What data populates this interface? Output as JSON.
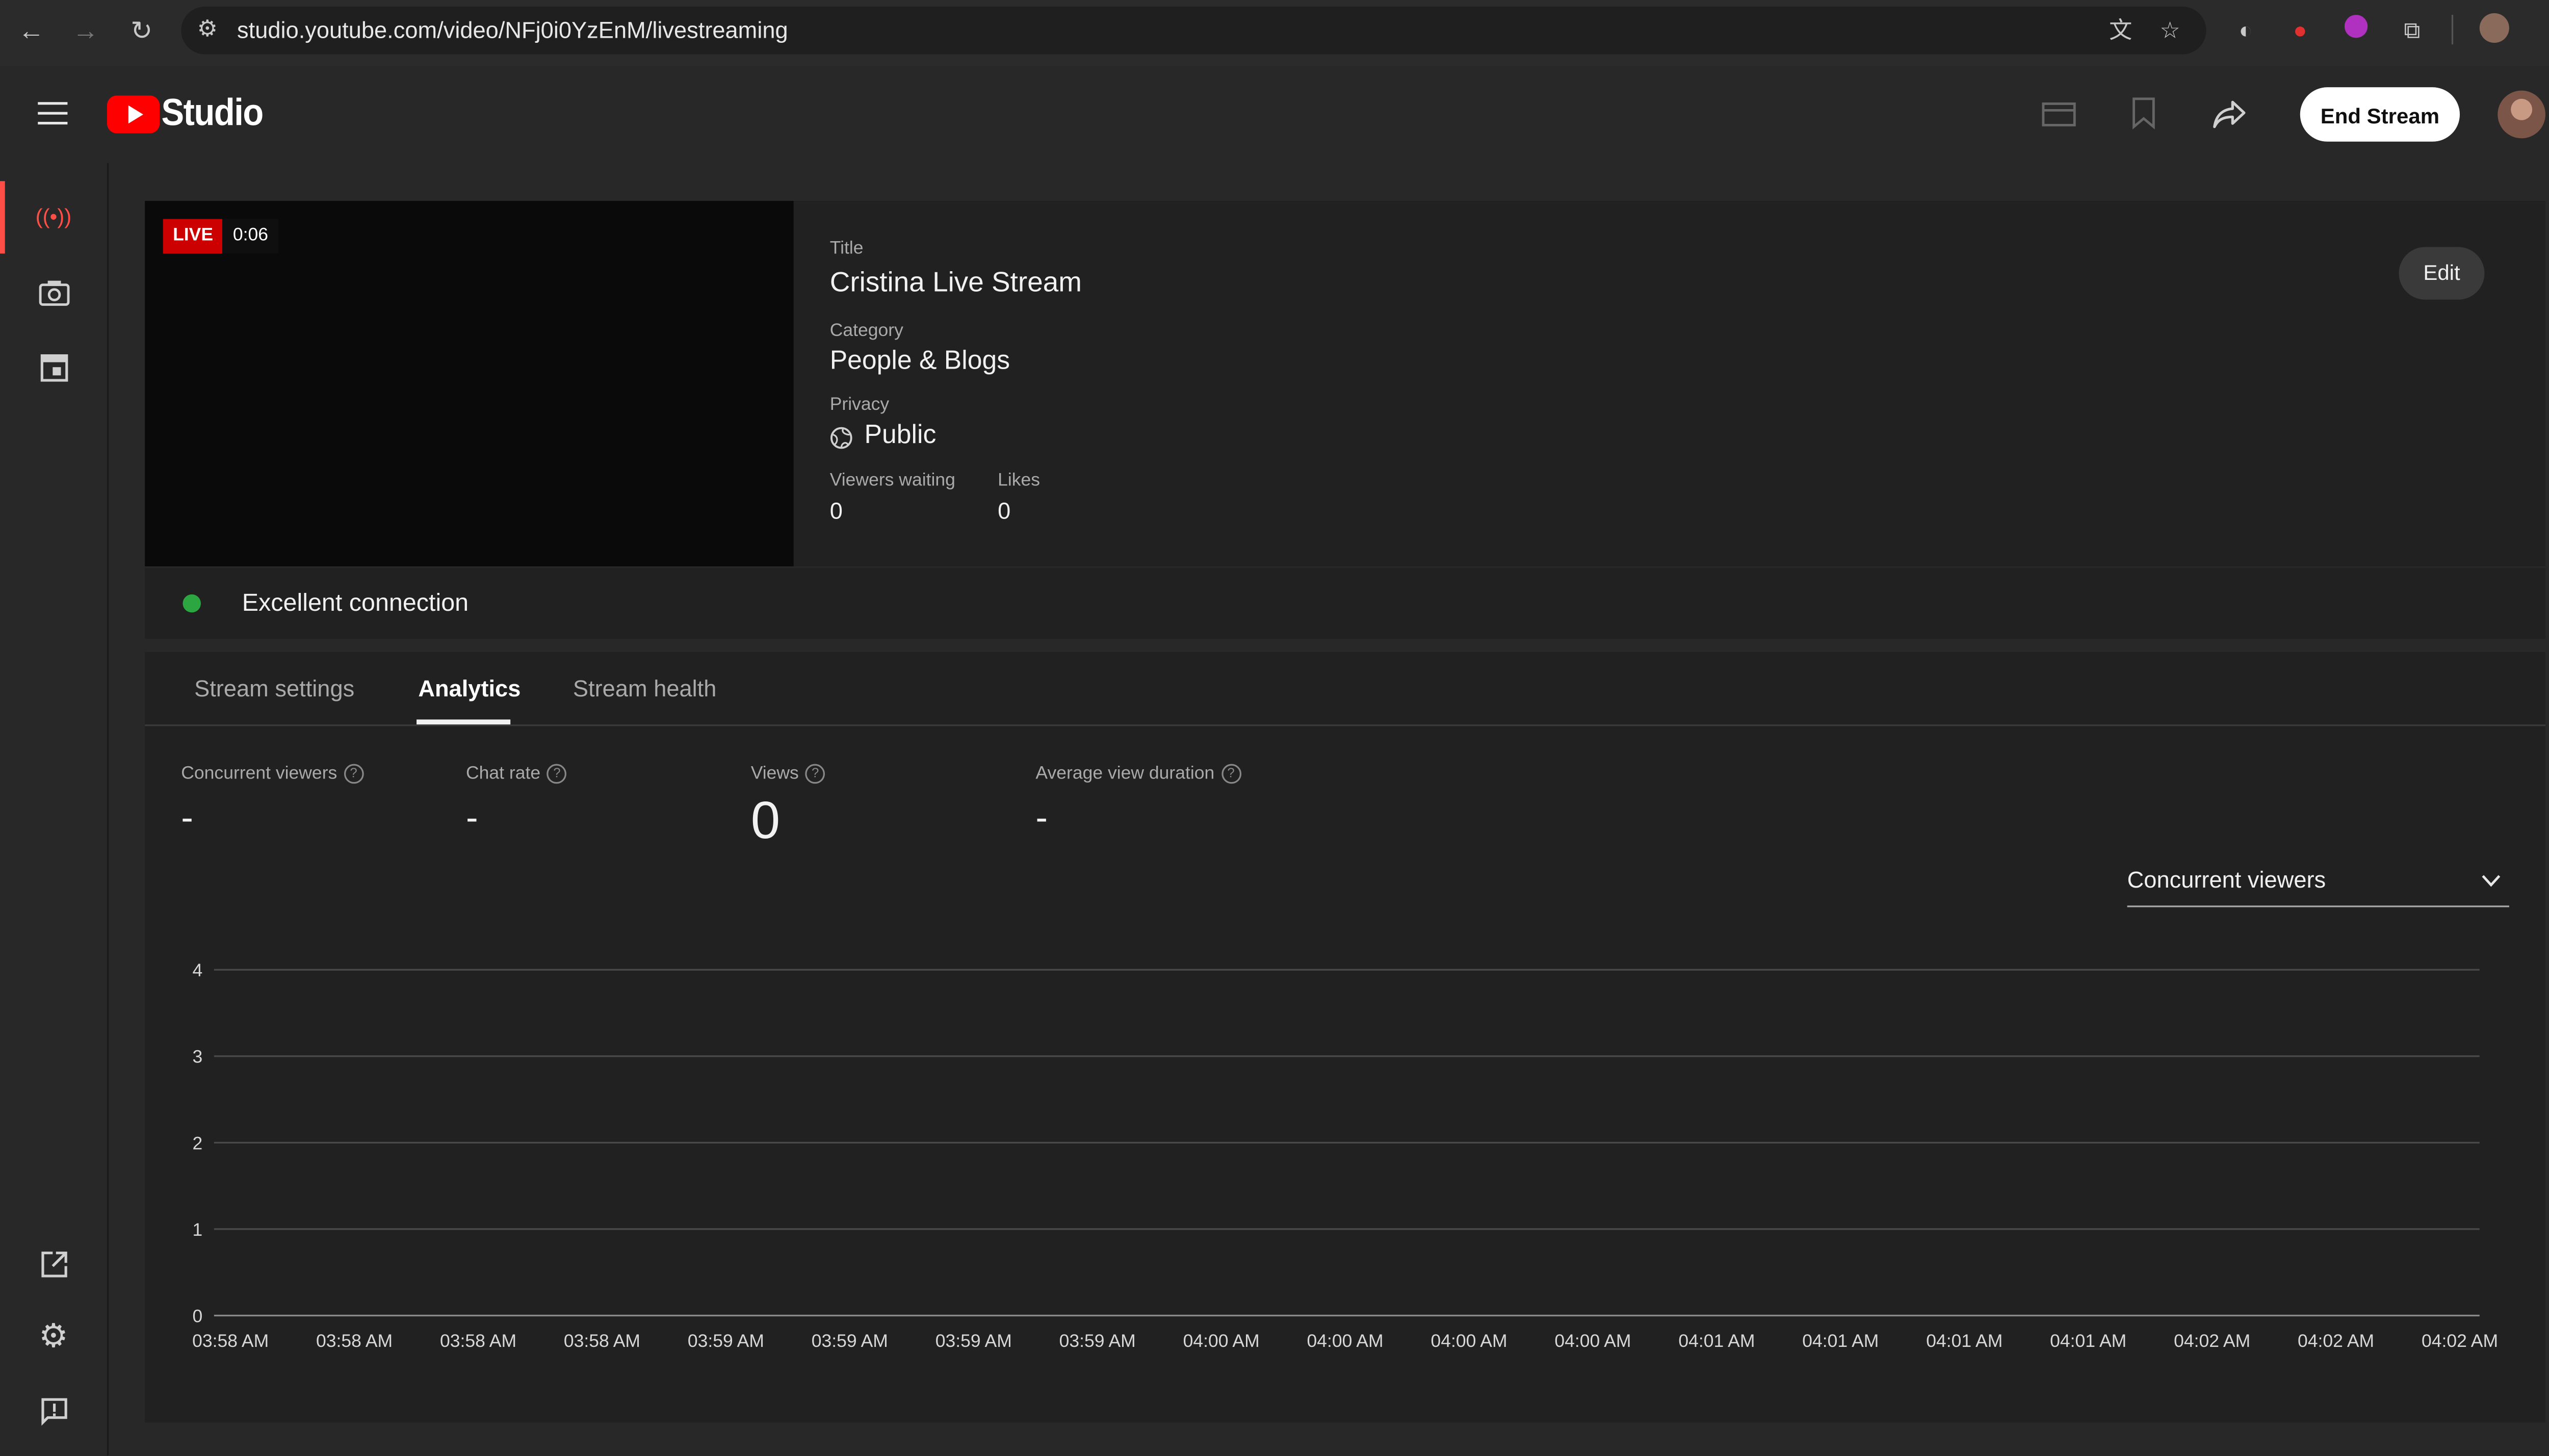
{
  "browser": {
    "url": "studio.youtube.com/video/NFj0i0YzEnM/livestreaming"
  },
  "header": {
    "logo_text": "Studio",
    "end_stream_label": "End Stream"
  },
  "stream": {
    "live_label": "LIVE",
    "elapsed": "0:06",
    "title_label": "Title",
    "title": "Cristina Live Stream",
    "category_label": "Category",
    "category": "People & Blogs",
    "privacy_label": "Privacy",
    "privacy": "Public",
    "viewers_waiting_label": "Viewers waiting",
    "viewers_waiting": "0",
    "likes_label": "Likes",
    "likes": "0",
    "edit_label": "Edit",
    "connection": "Excellent connection",
    "connection_color": "#2ba640"
  },
  "tabs": [
    {
      "label": "Stream settings",
      "active": false
    },
    {
      "label": "Analytics",
      "active": true
    },
    {
      "label": "Stream health",
      "active": false
    }
  ],
  "metrics": [
    {
      "label": "Concurrent viewers",
      "value": "-"
    },
    {
      "label": "Chat rate",
      "value": "-"
    },
    {
      "label": "Views",
      "value": "0"
    },
    {
      "label": "Average view duration",
      "value": "-"
    }
  ],
  "dropdown": {
    "selected": "Concurrent viewers"
  },
  "chart_data": {
    "type": "line",
    "x": [
      "03:58 AM",
      "03:58 AM",
      "03:58 AM",
      "03:58 AM",
      "03:59 AM",
      "03:59 AM",
      "03:59 AM",
      "03:59 AM",
      "04:00 AM",
      "04:00 AM",
      "04:00 AM",
      "04:00 AM",
      "04:01 AM",
      "04:01 AM",
      "04:01 AM",
      "04:01 AM",
      "04:02 AM",
      "04:02 AM",
      "04:02 AM"
    ],
    "y_ticks": [
      "0",
      "1",
      "2",
      "3",
      "4"
    ],
    "ylim": [
      0,
      4
    ],
    "series": [],
    "grid": true
  }
}
